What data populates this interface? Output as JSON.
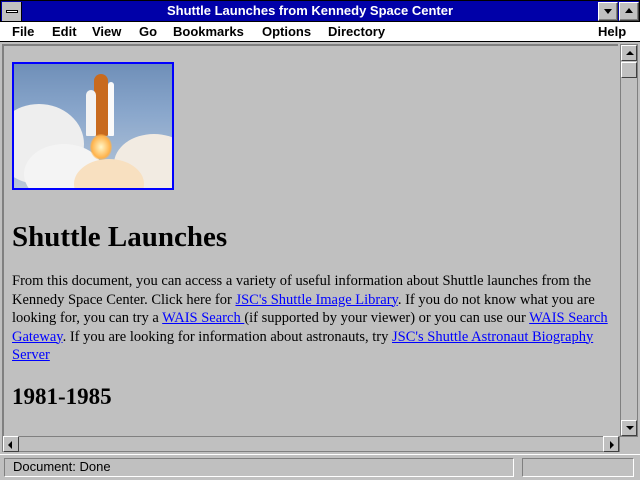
{
  "window": {
    "title": "Shuttle Launches from Kennedy Space Center"
  },
  "menu": {
    "file": "File",
    "edit": "Edit",
    "view": "View",
    "go": "Go",
    "bookmarks": "Bookmarks",
    "options": "Options",
    "directory": "Directory",
    "help": "Help"
  },
  "page": {
    "heading": "Shuttle Launches",
    "intro_1": "From this document, you can access a variety of useful information about Shuttle launches from the Kennedy Space Center. Click here for ",
    "link_image_library": "JSC's Shuttle Image Library",
    "intro_2": ". If you do not know what you are looking for, you can try a ",
    "link_wais_search": "WAIS Search ",
    "intro_3": "(if supported by your viewer) or you can use our ",
    "link_wais_gateway": "WAIS Search Gateway",
    "intro_4": ". If you are looking for information about astronauts, try ",
    "link_astronaut_server": "JSC's Shuttle Astronaut Biography Server",
    "section_heading": "1981-1985"
  },
  "status": {
    "text": "Document: Done",
    "progress_fraction": 0
  },
  "icons": {
    "system_menu": "system-menu-icon",
    "minimize": "minimize-icon",
    "maximize": "maximize-icon"
  },
  "colors": {
    "titlebar": "#0000a8",
    "link": "#0000ff",
    "window_bg": "#c0c0c0"
  }
}
